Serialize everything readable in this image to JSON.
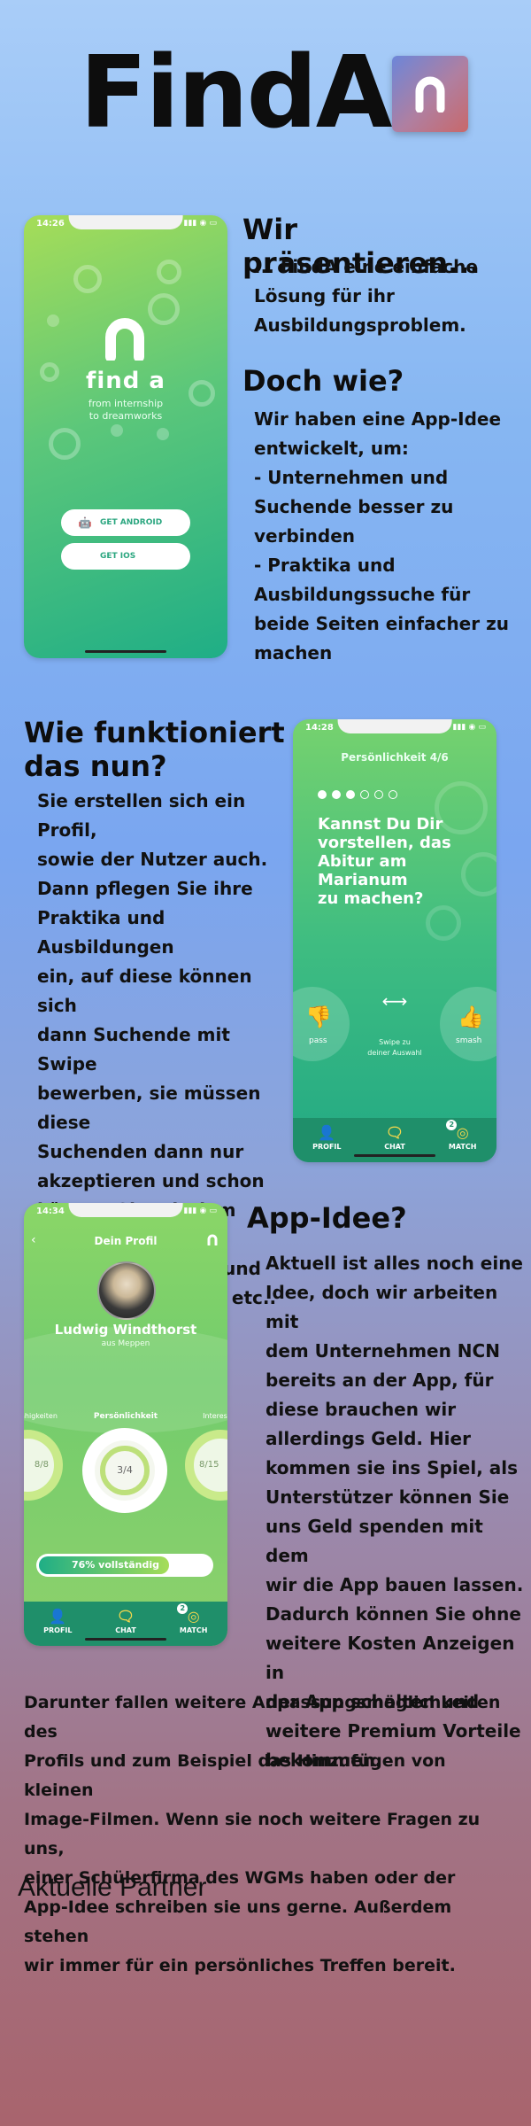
{
  "header": {
    "logo_text": "FindA",
    "app_icon": "finda-app-icon"
  },
  "section1": {
    "heading1": "Wir präsentieren...",
    "lines1": [
      "... FindA eine einfache",
      "Lösung für ihr",
      "Ausbildungsproblem."
    ],
    "heading2": "Doch wie?",
    "lines2": [
      "Wir haben eine App-Idee",
      "entwickelt, um:",
      "- Unternehmen und",
      "Suchende besser zu",
      "verbinden",
      "- Praktika und",
      "Ausbildungssuche für",
      "beide Seiten einfacher zu",
      "machen"
    ],
    "phone": {
      "time": "14:26",
      "brand": "find a",
      "tagline1": "from internship",
      "tagline2": "to dreamworks",
      "android_label": "GET ANDROID",
      "ios_label": "GET IOS"
    }
  },
  "section2": {
    "heading_l1": "Wie funktioniert",
    "heading_l2": "das nun?",
    "lines": [
      "Sie erstellen sich ein Profil,",
      "sowie der Nutzer auch.",
      "Dann pflegen Sie ihre",
      "Praktika und Ausbildungen",
      "ein, auf diese können sich",
      "dann Suchende mit Swipe",
      "bewerben, sie müssen diese",
      "Suchenden dann nur",
      "akzeptieren und schon",
      "können Sie mit dem Nutzer",
      "einen Chat führen und",
      "Termine abmachen etc.."
    ],
    "phone": {
      "time": "14:28",
      "title": "Persönlichkeit 4/6",
      "question": [
        "Kannst Du Dir",
        "vorstellen, das",
        "Abitur am",
        "Marianum",
        "zu machen?"
      ],
      "pass": "pass",
      "swipe1": "Swipe zu",
      "swipe2": "deiner Auswahl",
      "smash": "smash",
      "tabs": [
        "PROFIL",
        "CHAT",
        "MATCH"
      ],
      "badge": "2"
    }
  },
  "section3": {
    "heading": "App-Idee?",
    "lines": [
      "Aktuell ist alles noch eine",
      "Idee, doch wir arbeiten mit",
      "dem Unternehmen NCN",
      "bereits an der App, für",
      "diese brauchen wir",
      "allerdings Geld. Hier",
      "kommen sie ins Spiel, als",
      "Unterstützer können Sie",
      "uns Geld spenden mit dem",
      "wir die App bauen lassen.",
      "Dadurch können Sie ohne",
      "weitere Kosten Anzeigen in",
      "der App schalten und",
      "weitere Premium Vorteile",
      "bekommen."
    ],
    "full_lines": [
      "Darunter fallen weitere Anpassungsmöglichkeiten des",
      "Profils und zum Beispiel das Hinzufügen von kleinen",
      "Image-Filmen. Wenn sie noch weitere Fragen zu uns,",
      "einer Schülerfirma des WGMs haben oder der",
      "App-Idee schreiben sie uns gerne. Außerdem stehen",
      "wir immer für ein persönliches Treffen bereit."
    ],
    "phone": {
      "time": "14:34",
      "title": "Dein Profil",
      "name": "Ludwig Windthorst",
      "location": "aus Meppen",
      "cat_left": "ähigkeiten",
      "cat_center": "Persönlichkeit",
      "cat_right": "Interess",
      "left_score": "8/8",
      "center_score": "3/4",
      "right_score": "8/15",
      "progress_label": "76% vollständig",
      "progress": 0.76,
      "tabs": [
        "PROFIL",
        "CHAT",
        "MATCH"
      ],
      "badge": "2"
    }
  },
  "footer": {
    "partners": "Aktuelle Partner"
  }
}
